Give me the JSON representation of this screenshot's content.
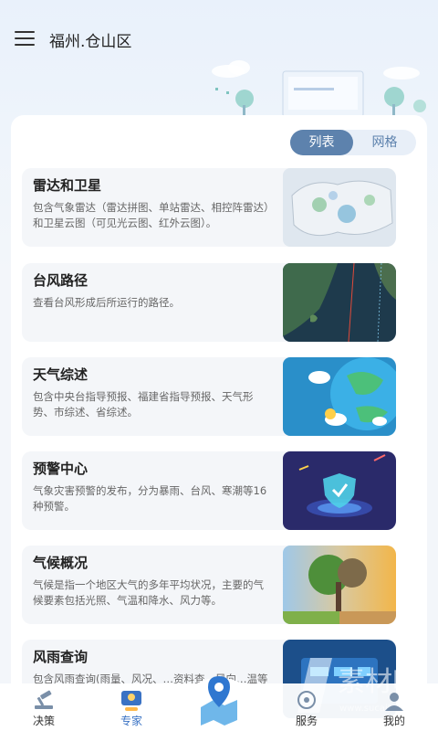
{
  "header": {
    "city": "福州.仓山区"
  },
  "view_toggle": {
    "list_label": "列表",
    "grid_label": "网格",
    "selected": "列表"
  },
  "cards": [
    {
      "title": "雷达和卫星",
      "desc": "包含气象雷达（雷达拼图、单站雷达、相控阵雷达）和卫星云图（可见光云图、红外云图）。"
    },
    {
      "title": "台风路径",
      "desc": "查看台风形成后所运行的路径。"
    },
    {
      "title": "天气综述",
      "desc": "包含中央台指导预报、福建省指导预报、天气形势、市综述、省综述。"
    },
    {
      "title": "预警中心",
      "desc": "气象灾害预警的发布，分为暴雨、台风、寒潮等16种预警。"
    },
    {
      "title": "气候概况",
      "desc": "气候是指一个地区大气的多年平均状况，主要的气候要素包括光照、气温和降水、风力等。"
    },
    {
      "title": "风雨查询",
      "desc": "包含风雨查询(雨量、风况、…资料查…风向…温等"
    }
  ],
  "bottom_nav": {
    "items": [
      {
        "label": "决策",
        "icon": "gavel-icon"
      },
      {
        "label": "专家",
        "icon": "expert-icon",
        "active": true
      },
      {
        "label": "",
        "icon": "location-map-icon"
      },
      {
        "label": "服务",
        "icon": "service-icon"
      },
      {
        "label": "我的",
        "icon": "user-icon"
      }
    ]
  },
  "watermark": {
    "text": "素材吧",
    "url": "www.sucaibar.com"
  },
  "colors": {
    "accent": "#5d82ad",
    "active_tab": "#3a72c4",
    "card_bg": "#f4f6f9"
  }
}
